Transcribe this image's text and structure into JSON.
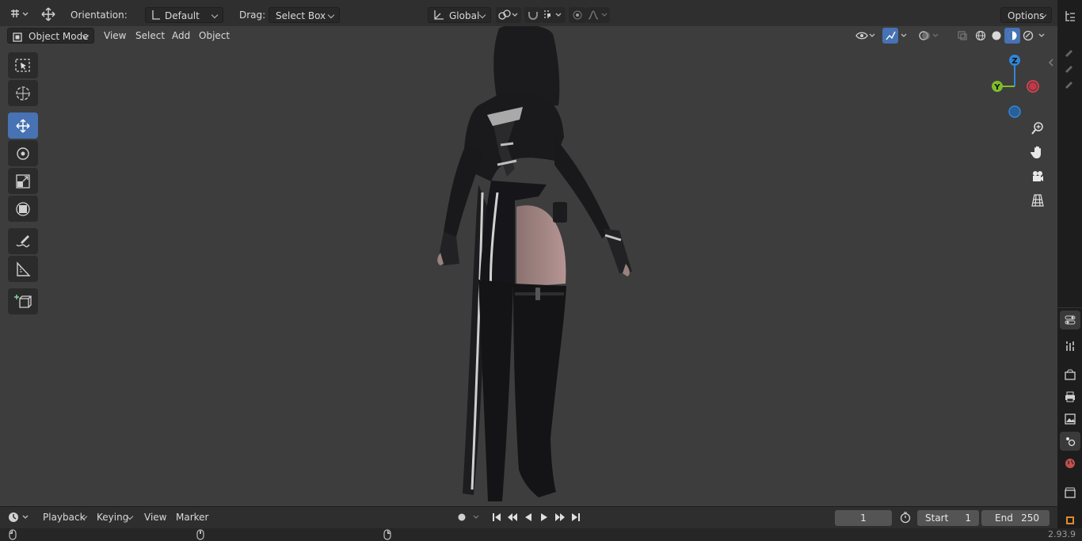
{
  "header": {
    "orientation_label": "Orientation:",
    "orientation_value": "Default",
    "drag_label": "Drag:",
    "drag_value": "Select Box",
    "transform_orientation": "Global",
    "options_label": "Options"
  },
  "viewport_header": {
    "mode": "Object Mode",
    "menus": [
      "View",
      "Select",
      "Add",
      "Object"
    ]
  },
  "toolbar": {
    "tools": [
      "select-box-icon",
      "cursor-icon",
      "move-icon",
      "rotate-icon",
      "scale-icon",
      "transform-icon",
      "annotate-icon",
      "measure-icon",
      "add-cube-icon"
    ],
    "active": "move-icon"
  },
  "gizmo": {
    "x_label": "",
    "y_label": "Y",
    "z_label": "Z"
  },
  "timeline": {
    "menus": [
      "Playback",
      "Keying",
      "View",
      "Marker"
    ],
    "current_frame": "1",
    "start_label": "Start",
    "start_value": "1",
    "end_label": "End",
    "end_value": "250"
  },
  "status": {
    "version": "2.93.9"
  },
  "colors": {
    "accent": "#4772b3",
    "axis_x": "#e0404f",
    "axis_y": "#7fbd2a",
    "axis_z": "#2f86d8"
  }
}
